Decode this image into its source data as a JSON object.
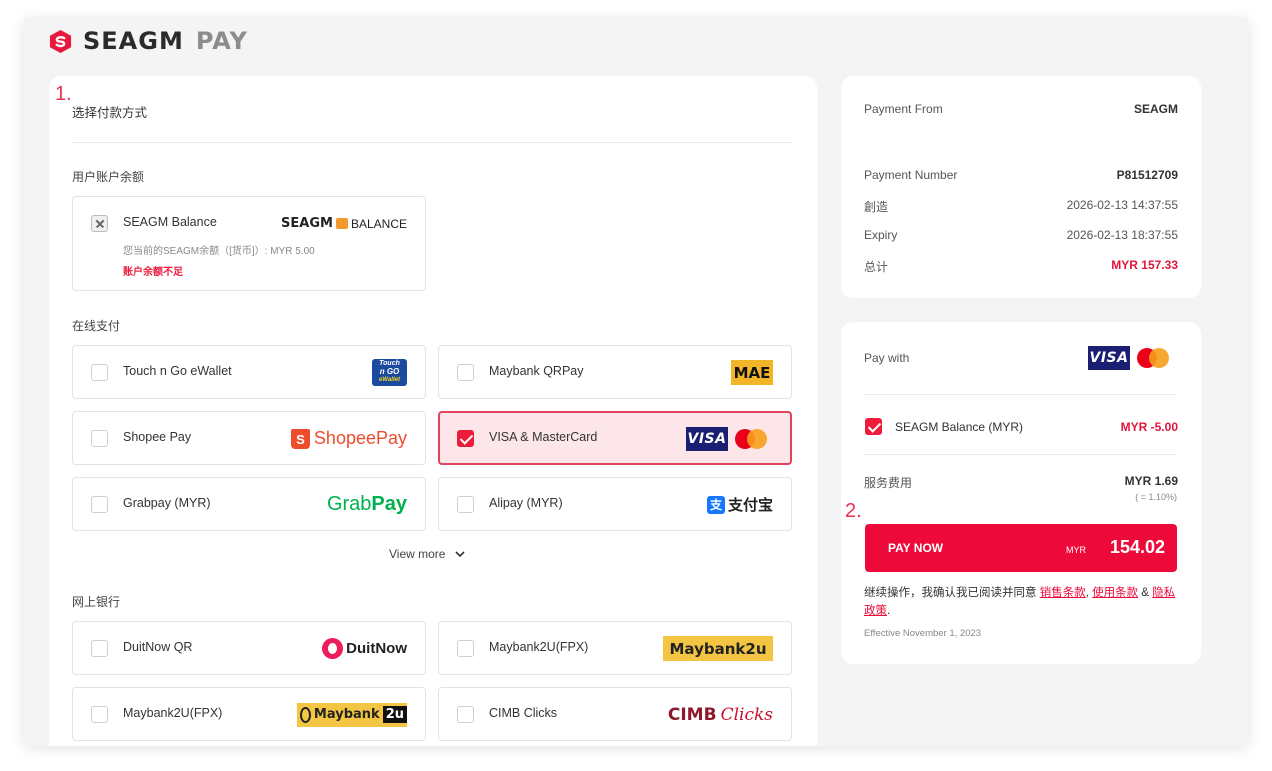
{
  "brand": {
    "name": "SEAGM",
    "suffix": "PAY"
  },
  "markers": {
    "one": "1.",
    "two": "2."
  },
  "left": {
    "title": "选择付款方式",
    "sections": {
      "balance": "用户账户余额",
      "online": "在线支付",
      "banking": "网上银行"
    },
    "balance_card": {
      "label": "SEAGM Balance",
      "logo_text": "SEAGM",
      "logo_suffix": "BALANCE",
      "sub": "您当前的SEAGM余额（[货币]）: MYR 5.00",
      "warning": "账户余额不足"
    },
    "online_methods": [
      {
        "label": "Touch n Go eWallet",
        "logo": "Touch n GO eWallet",
        "logo_line1": "Touch",
        "logo_line2": "n GO",
        "logo_line3": "eWallet"
      },
      {
        "label": "Maybank QRPay",
        "logo": "MAE"
      },
      {
        "label": "Shopee Pay",
        "logo": "ShopeePay"
      },
      {
        "label": "VISA & MasterCard",
        "logo": "VISA",
        "selected": true
      },
      {
        "label": "Grabpay (MYR)",
        "logo_a": "Grab",
        "logo_b": "Pay"
      },
      {
        "label": "Alipay (MYR)",
        "logo_mark": "支",
        "logo": "支付宝"
      }
    ],
    "view_more": "View more",
    "bank_methods": [
      {
        "label": "DuitNow QR",
        "logo": "DuitNow"
      },
      {
        "label": "Maybank2U(FPX)",
        "logo": "Maybank2u"
      },
      {
        "label": "Maybank2U(FPX)",
        "logo_a": "Maybank",
        "logo_b": "2u"
      },
      {
        "label": "CIMB Clicks",
        "logo_a": "CIMB",
        "logo_b": "Clicks"
      }
    ]
  },
  "summary": {
    "payment_from_label": "Payment From",
    "payment_from_value": "SEAGM",
    "payment_number_label": "Payment Number",
    "payment_number_value": "P81512709",
    "created_label": "創造",
    "created_value": "2026-02-13 14:37:55",
    "expiry_label": "Expiry",
    "expiry_value": "2026-02-13 18:37:55",
    "total_label": "总计",
    "total_value": "MYR 157.33"
  },
  "pay": {
    "pay_with_label": "Pay with",
    "visa_text": "VISA",
    "balance_label": "SEAGM Balance (MYR)",
    "balance_value": "MYR -5.00",
    "fee_label": "服务费用",
    "fee_value": "MYR 1.69",
    "fee_rate": "( = 1.10%)",
    "button_label": "PAY NOW",
    "button_currency": "MYR",
    "button_amount": "154.02",
    "terms_prefix": "继续操作，我确认我已阅读并同意 ",
    "terms_sales": "销售条款",
    "terms_sep1": ", ",
    "terms_use": "使用条款",
    "terms_sep2": " & ",
    "terms_privacy": "隐私政策",
    "terms_end": ".",
    "effective": "Effective November 1, 2023"
  },
  "colors": {
    "accent": "#ed0a3b",
    "selected_bg": "#fde6ea",
    "visa_blue": "#1a1f71"
  }
}
